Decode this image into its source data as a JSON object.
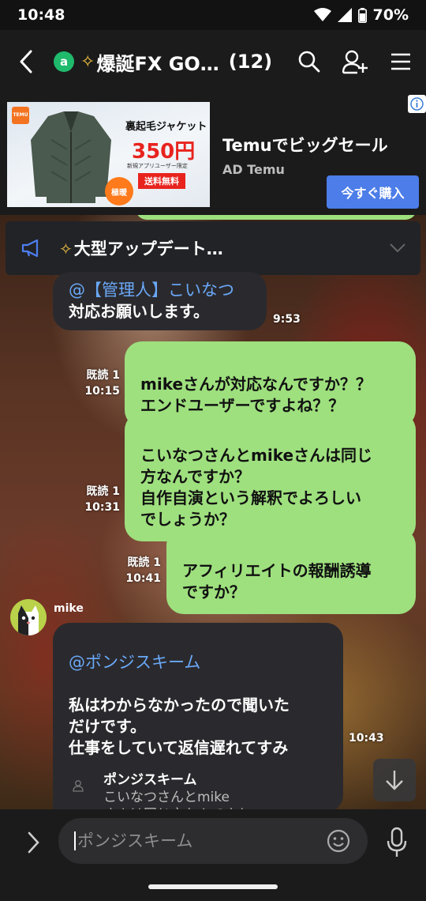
{
  "status_bar": {
    "time": "10:48",
    "battery": "70%"
  },
  "header": {
    "back_icon": "back-arrow-icon",
    "badge": "a",
    "sparkle": "✧",
    "title": "爆誕FX GO…",
    "count": "(12)",
    "icons": [
      "search-icon",
      "add-friend-icon",
      "menu-icon"
    ]
  },
  "ad": {
    "title": "Temuでビッグセール",
    "sub": "AD  Temu",
    "cta": "今すぐ購入",
    "image": {
      "logo": "TEMU",
      "product": "裏起毛ジャケット",
      "price": "350円",
      "note": "新規アプリユーザー限定",
      "shipping": "送料無料",
      "badge": "極暖"
    }
  },
  "notice": {
    "sparkle": "✧",
    "text": "大型アップデート…"
  },
  "messages": [
    {
      "side": "left",
      "mention": "@【管理人】こいなつ",
      "text": "対応お願いします。",
      "time": "9:53"
    },
    {
      "side": "right",
      "read": "既読 1",
      "time": "10:15",
      "text": "mikeさんが対応なんですか？？\nエンドユーザーですよね？？"
    },
    {
      "side": "right",
      "read": "既読 1",
      "time": "10:31",
      "text": "こいなつさんとmikeさんは同じ\n方なんですか？\n自作自演という解釈でよろしい\nでしょうか？"
    },
    {
      "side": "right",
      "read": "既読 1",
      "time": "10:41",
      "text": "アフィリエイトの報酬誘導\nですか？"
    },
    {
      "side": "left",
      "sender": "mike",
      "mention": "@ポンジスキーム",
      "text": "私はわからなかったので聞いた\nだけです。\n仕事をしていて返信遅れてすみ\nません。",
      "time": "10:43"
    }
  ],
  "reply_preview": {
    "name": "ポンジスキーム",
    "text": "こいなつさんとmike\nさんは同じ方なんですか"
  },
  "input": {
    "placeholder": "ポンジスキーム"
  },
  "colors": {
    "green_bubble": "#9ee07e",
    "dark_bubble": "#2a2a2e",
    "mention": "#6aa8f7",
    "cta": "#4c7de8",
    "open_badge": "#1fba6c"
  }
}
